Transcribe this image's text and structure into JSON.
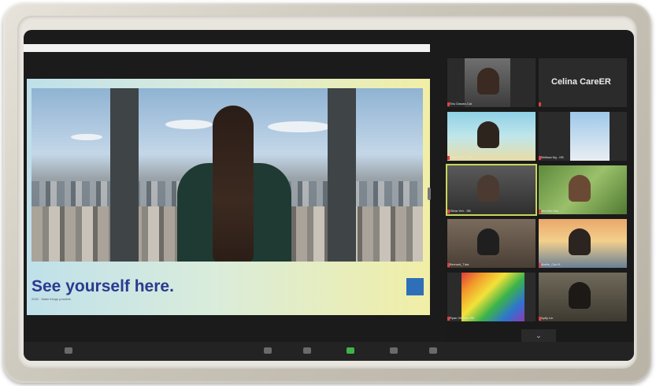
{
  "slide": {
    "heading": "See yourself here.",
    "subtext": "2020 · Make things possible.",
    "logo_color": "#2e6fb8"
  },
  "gallery": {
    "featured_name": "Celina CareER",
    "participants": [
      {
        "name": "Shu Dawan-Cai"
      },
      {
        "name": ""
      },
      {
        "name": "Ivica Chan - SB"
      },
      {
        "name": "Melissa Ng - KB"
      },
      {
        "name": "Olivia Yeh - SB"
      },
      {
        "name": "Jennifer Kim"
      },
      {
        "name": "Bernard_Tuta"
      },
      {
        "name": "Martin_Carl K."
      },
      {
        "name": "Ryan Gilberto RB"
      },
      {
        "name": "Aptly Lin"
      }
    ],
    "more_icon": "chevron-down-icon"
  },
  "colors": {
    "active_speaker": "#c9d65a",
    "muted_mic": "#e04040",
    "share_button": "#3fb34a"
  }
}
